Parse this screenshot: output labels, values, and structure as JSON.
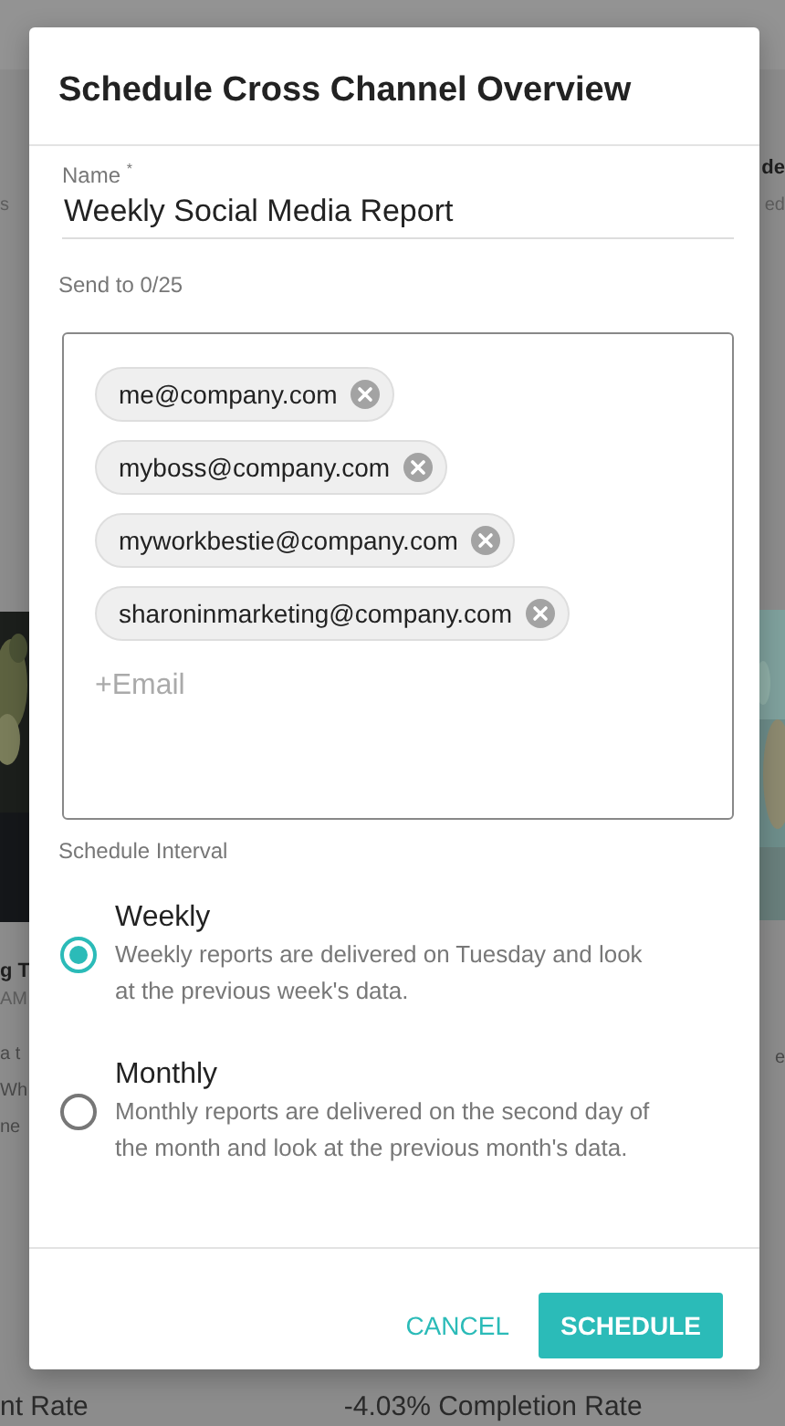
{
  "background": {
    "left_texts": [
      {
        "text": "s",
        "kind": "muted"
      },
      {
        "text": "g T",
        "kind": "strong"
      },
      {
        "text": "AM",
        "kind": "muted"
      },
      {
        "text": "a t",
        "kind": "body"
      },
      {
        "text": "Wh",
        "kind": "body"
      },
      {
        "text": "ne",
        "kind": "body"
      }
    ],
    "right_texts": [
      {
        "text": "de",
        "kind": "strong"
      },
      {
        "text": "ed",
        "kind": "muted"
      },
      {
        "text": "e",
        "kind": "body"
      }
    ],
    "bottom_texts": [
      "nt Rate",
      "-4.03% Completion Rate"
    ]
  },
  "dialog": {
    "title": "Schedule Cross Channel Overview",
    "name_field": {
      "label": "Name $^{*}$",
      "value": "Weekly Social Media Report"
    },
    "send_to_label": "Send to 0/25",
    "recipients": [
      "me@company.com",
      "myboss@company.com",
      "myworkbestie@company.com",
      "sharoninmarketing@company.com"
    ],
    "email_placeholder": "+Email",
    "interval_label": "Schedule Interval",
    "intervals": [
      {
        "title": "Weekly",
        "description": "Weekly reports are delivered on Tuesday and look at the previous week's data.",
        "selected": true
      },
      {
        "title": "Monthly",
        "description": "Monthly reports are delivered on the second day of the month and look at the previous month's data.",
        "selected": false
      }
    ],
    "buttons": [
      {
        "label": "CANCEL",
        "kind": "text"
      },
      {
        "label": "SCHEDULE",
        "kind": "primary"
      }
    ]
  }
}
